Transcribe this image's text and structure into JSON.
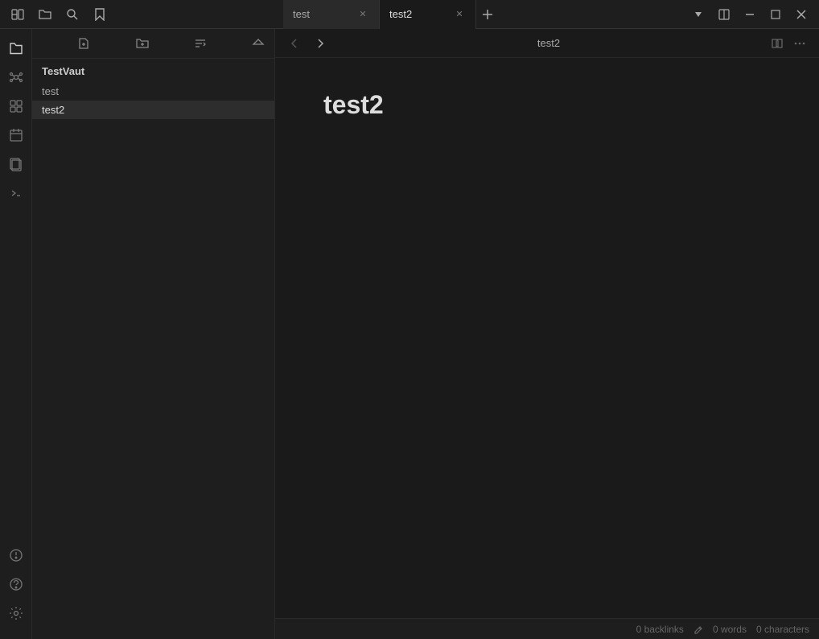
{
  "titlebar": {
    "tabs": [
      {
        "label": "test",
        "active": false,
        "id": "tab-test"
      },
      {
        "label": "test2",
        "active": true,
        "id": "tab-test2"
      }
    ],
    "new_tab_label": "+",
    "window_controls": {
      "dropdown": "▾",
      "layout": "⊞",
      "minimize": "−",
      "maximize": "□",
      "close": "✕"
    }
  },
  "sidebar": {
    "icons": [
      {
        "name": "sidebar-toggle",
        "glyph": "☰"
      },
      {
        "name": "open-folder",
        "glyph": "📁"
      },
      {
        "name": "search",
        "glyph": "🔍"
      },
      {
        "name": "bookmark",
        "glyph": "☆"
      }
    ],
    "bottom_icons": [
      {
        "name": "graph-view",
        "glyph": "⬡"
      },
      {
        "name": "plugins",
        "glyph": "⚙"
      },
      {
        "name": "starred",
        "glyph": "⭐"
      },
      {
        "name": "daily-notes",
        "glyph": "📅"
      },
      {
        "name": "templates",
        "glyph": "❏"
      },
      {
        "name": "terminal",
        "glyph": ">_"
      }
    ]
  },
  "file_panel": {
    "toolbar": {
      "new_note": "✏",
      "new_folder": "📁",
      "sort": "↕",
      "collapse": "◇"
    },
    "vault_name": "TestVaut",
    "files": [
      {
        "name": "test",
        "active": false
      },
      {
        "name": "test2",
        "active": true
      }
    ]
  },
  "editor": {
    "nav": {
      "back": "←",
      "forward": "→"
    },
    "title": "test2",
    "actions": {
      "reading_view": "📖",
      "more_options": "⋯"
    },
    "heading": "test2"
  },
  "statusbar": {
    "backlinks": "0 backlinks",
    "edit_icon": "✏",
    "words": "0 words",
    "characters": "0 characters"
  }
}
